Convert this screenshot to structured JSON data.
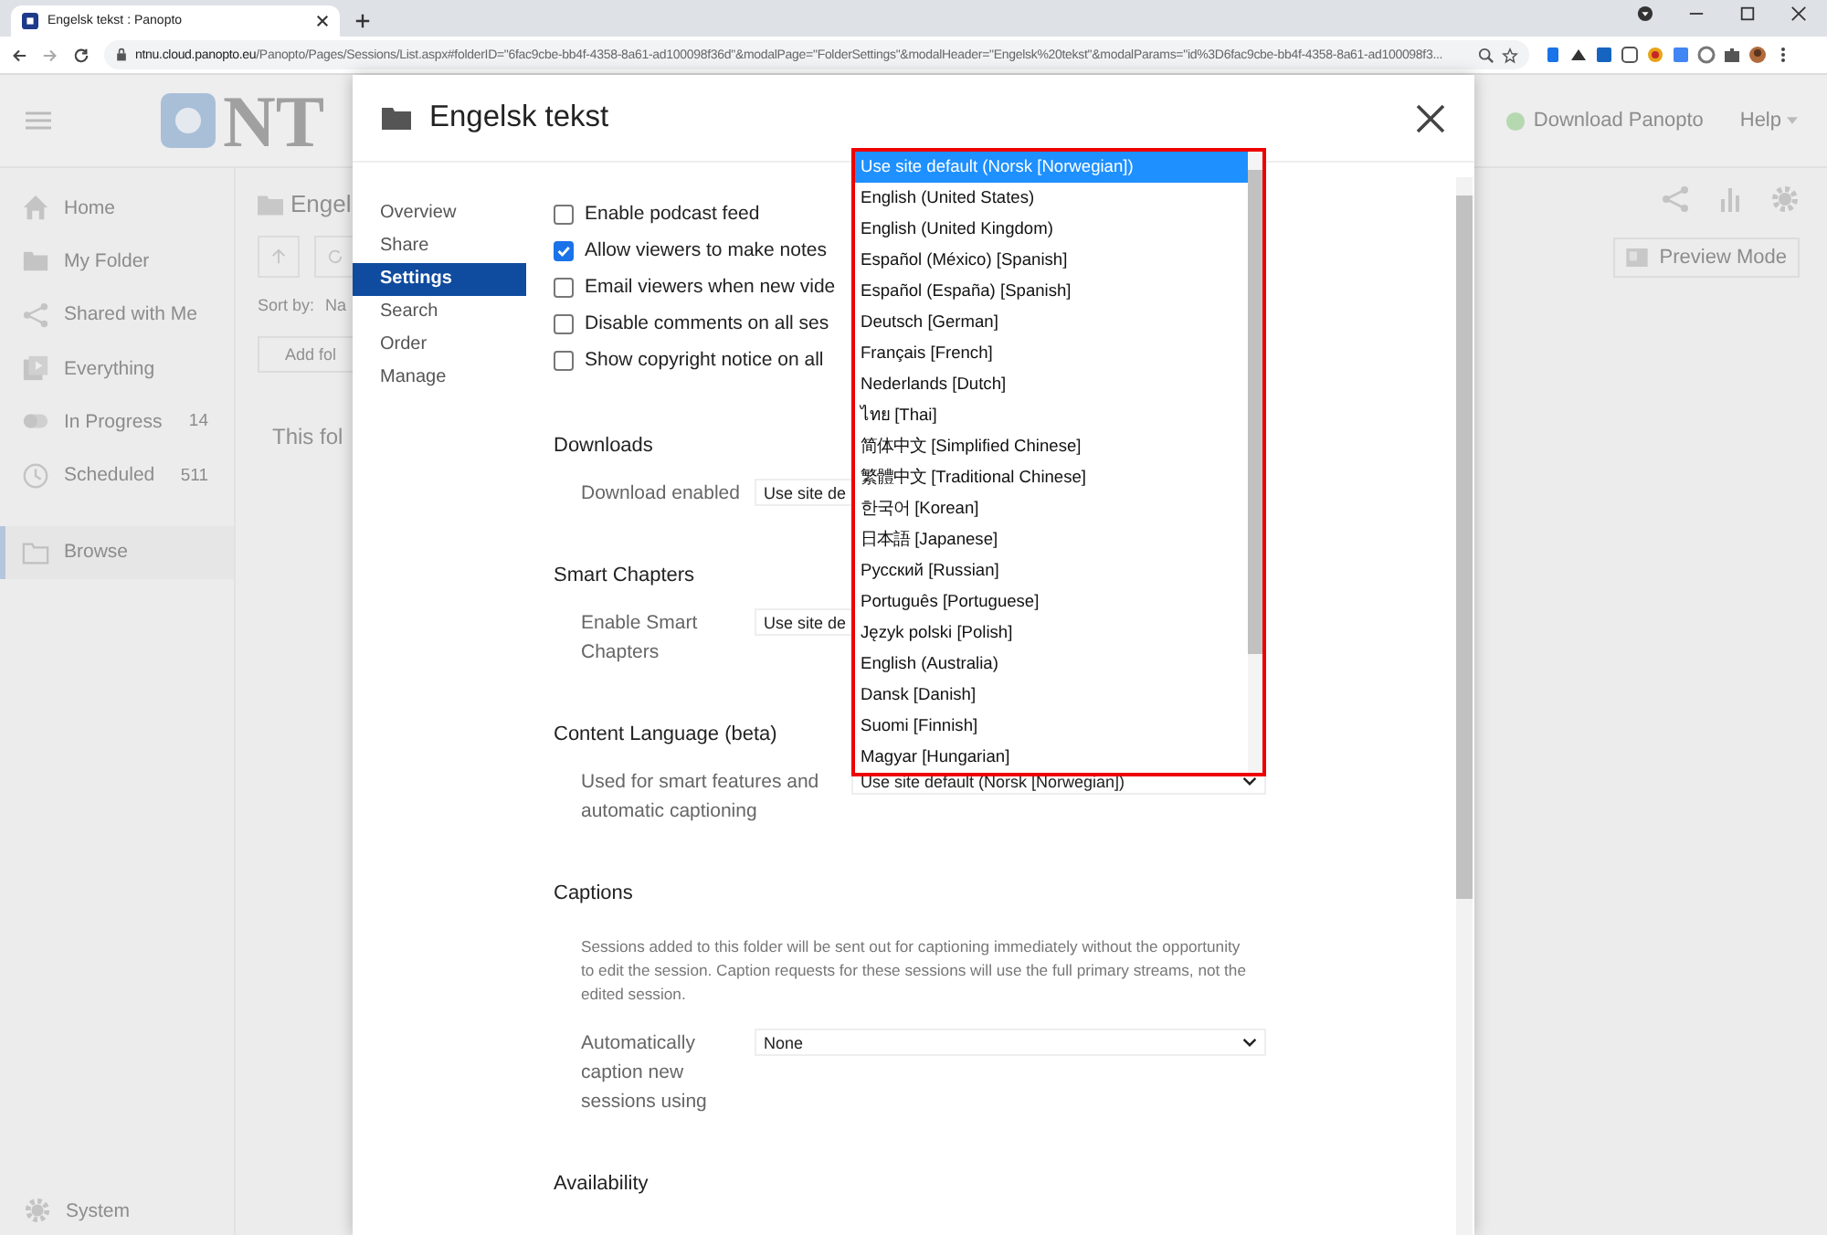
{
  "browser": {
    "tab_title": "Engelsk tekst : Panopto",
    "url_host": "ntnu.cloud.panopto.eu",
    "url_path": "/Panopto/Pages/Sessions/List.aspx#folderID=\"6fac9cbe-bb4f-4358-8a61-ad100098f36d\"&modalPage=\"FolderSettings\"&modalHeader=\"Engelsk%20tekst\"&modalParams=\"id%3D6fac9cbe-bb4f-4358-8a61-ad100098f3..."
  },
  "app": {
    "logo_text": "NT",
    "download": "Download Panopto",
    "help": "Help",
    "sidebar": [
      {
        "label": "Home",
        "selected": false
      },
      {
        "label": "My Folder",
        "selected": false
      },
      {
        "label": "Shared with Me",
        "selected": false
      },
      {
        "label": "Everything",
        "selected": false
      },
      {
        "label": "In Progress",
        "count": "14",
        "selected": false
      },
      {
        "label": "Scheduled",
        "count": "511",
        "selected": false
      },
      {
        "label": "Browse",
        "selected": true
      }
    ],
    "system": "System",
    "folder_title": "Engel",
    "sort_label": "Sort by:",
    "sort_value": "Na",
    "add_folder": "Add fol",
    "empty_text": "This fol",
    "preview_mode": "Preview Mode"
  },
  "modal": {
    "title": "Engelsk tekst",
    "nav": [
      {
        "label": "Overview",
        "selected": false
      },
      {
        "label": "Share",
        "selected": false
      },
      {
        "label": "Settings",
        "selected": true
      },
      {
        "label": "Search",
        "selected": false
      },
      {
        "label": "Order",
        "selected": false
      },
      {
        "label": "Manage",
        "selected": false
      }
    ],
    "options": [
      {
        "label": "Enable podcast feed",
        "checked": false
      },
      {
        "label": "Allow viewers to make notes",
        "checked": true
      },
      {
        "label": "Email viewers when new vide",
        "checked": false
      },
      {
        "label": "Disable comments on all ses",
        "checked": false
      },
      {
        "label": "Show copyright notice on all",
        "checked": false
      }
    ],
    "sections": [
      {
        "heading": "Downloads",
        "rows": [
          {
            "label": "Download enabled",
            "value": "Use site de"
          }
        ]
      },
      {
        "heading": "Smart Chapters",
        "rows": [
          {
            "label": "Enable Smart Chapters",
            "value": "Use site de"
          }
        ]
      },
      {
        "heading": "Content Language (beta)",
        "rows": [
          {
            "label": "Used for smart features and automatic captioning",
            "value": "Use site default (Norsk [Norwegian])"
          }
        ]
      },
      {
        "heading": "Captions",
        "description": "Sessions added to this folder will be sent out for captioning immediately without the opportunity to edit the session. Caption requests for these sessions will use the full primary streams, not the edited session.",
        "rows": [
          {
            "label": "Automatically caption new sessions using",
            "value": "None"
          }
        ]
      },
      {
        "heading": "Availability"
      }
    ]
  },
  "language_list": {
    "items": [
      {
        "label": "Use site default (Norsk [Norwegian])",
        "selected": true
      },
      {
        "label": "English (United States)",
        "selected": false
      },
      {
        "label": "English (United Kingdom)",
        "selected": false
      },
      {
        "label": "Español (México) [Spanish]",
        "selected": false
      },
      {
        "label": "Español (España) [Spanish]",
        "selected": false
      },
      {
        "label": "Deutsch [German]",
        "selected": false
      },
      {
        "label": "Français [French]",
        "selected": false
      },
      {
        "label": "Nederlands [Dutch]",
        "selected": false
      },
      {
        "label": "ไทย [Thai]",
        "selected": false
      },
      {
        "label": "简体中文 [Simplified Chinese]",
        "selected": false
      },
      {
        "label": "繁體中文 [Traditional Chinese]",
        "selected": false
      },
      {
        "label": "한국어 [Korean]",
        "selected": false
      },
      {
        "label": "日本語 [Japanese]",
        "selected": false
      },
      {
        "label": "Русский [Russian]",
        "selected": false
      },
      {
        "label": "Português [Portuguese]",
        "selected": false
      },
      {
        "label": "Język polski [Polish]",
        "selected": false
      },
      {
        "label": "English (Australia)",
        "selected": false
      },
      {
        "label": "Dansk [Danish]",
        "selected": false
      },
      {
        "label": "Suomi [Finnish]",
        "selected": false
      },
      {
        "label": "Magyar [Hungarian]",
        "selected": false
      }
    ]
  }
}
